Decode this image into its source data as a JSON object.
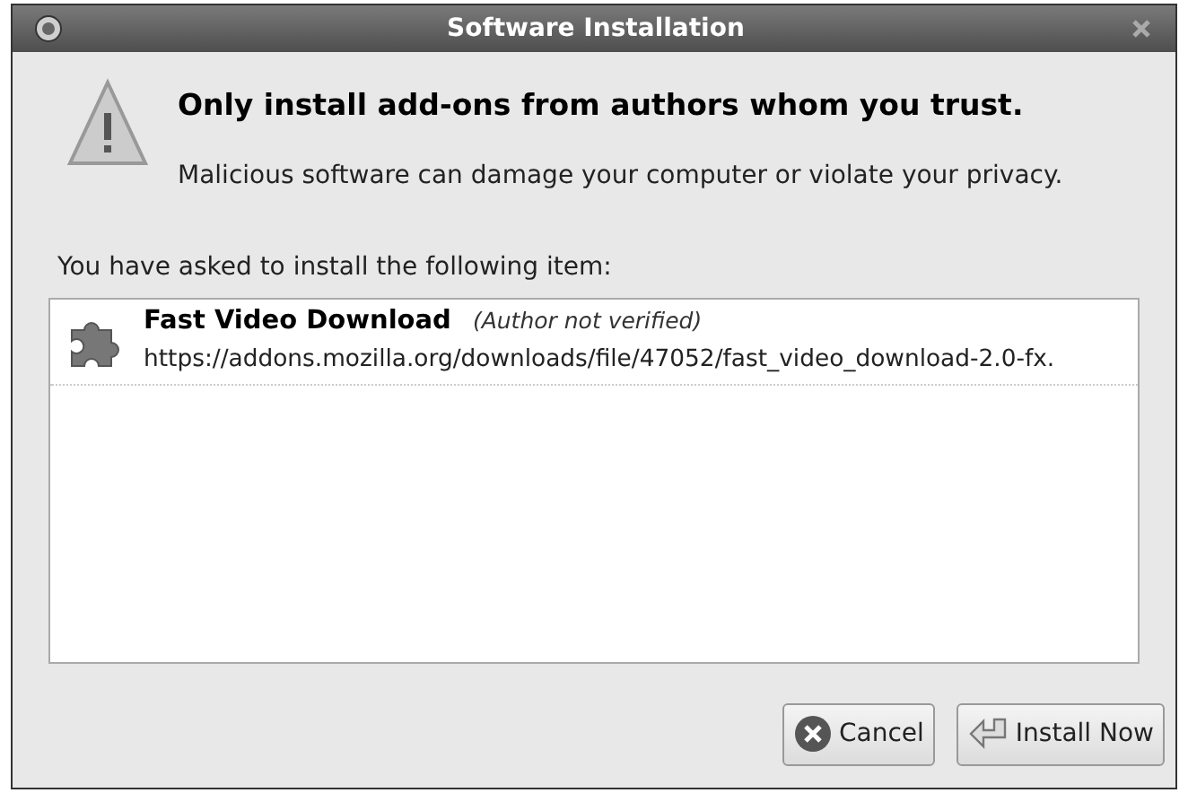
{
  "window": {
    "title": "Software Installation"
  },
  "heading": "Only install add-ons from authors whom you trust.",
  "warning": "Malicious software can damage your computer or violate your privacy.",
  "prompt": "You have asked to install the following item:",
  "items": [
    {
      "name": "Fast Video Download",
      "note": "(Author not verified)",
      "url": "https://addons.mozilla.org/downloads/file/47052/fast_video_download-2.0-fx."
    }
  ],
  "buttons": [
    {
      "kind": "cancel",
      "label": "Cancel"
    },
    {
      "kind": "install",
      "label": "Install Now"
    }
  ]
}
